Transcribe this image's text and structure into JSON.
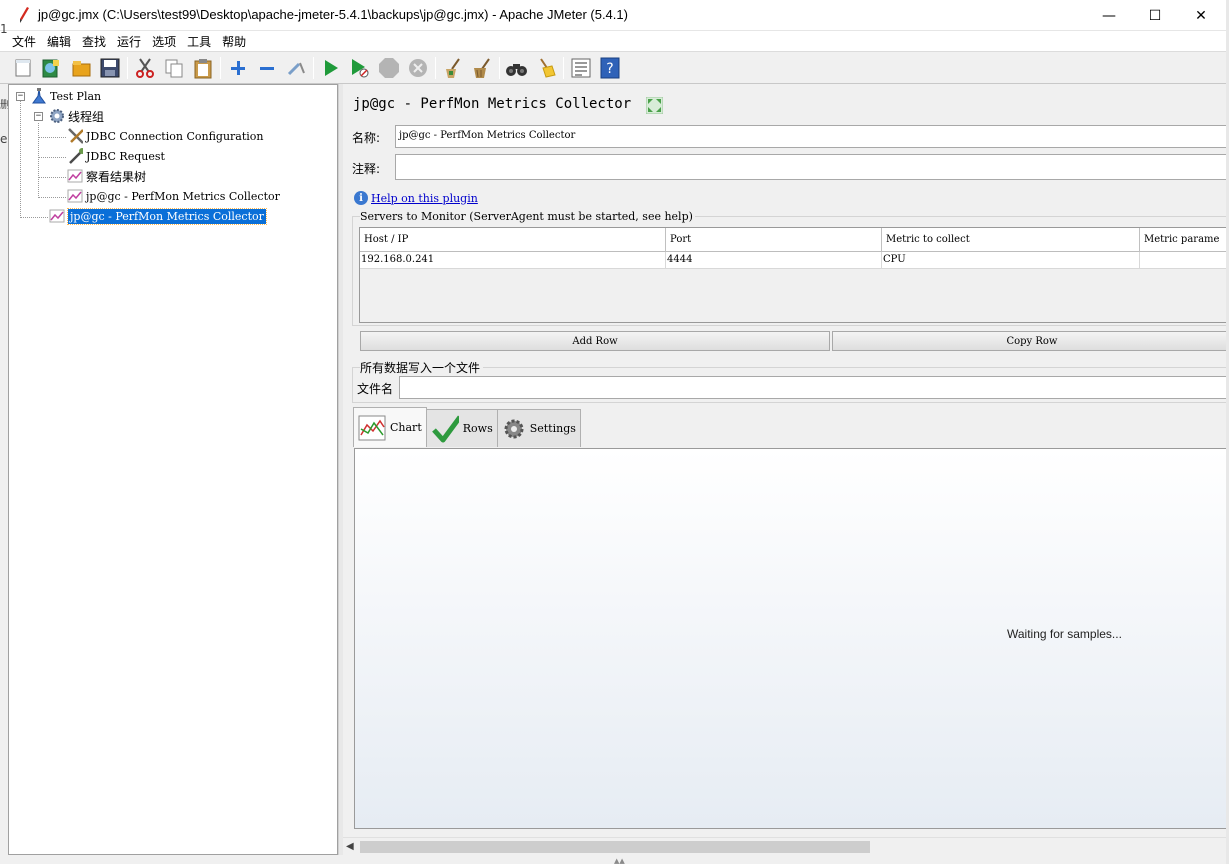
{
  "window": {
    "title": "jp@gc.jmx (C:\\Users\\test99\\Desktop\\apache-jmeter-5.4.1\\backups\\jp@gc.jmx) - Apache JMeter (5.4.1)",
    "minimize": "—",
    "maximize": "☐",
    "close": "✕"
  },
  "menu": [
    "文件",
    "编辑",
    "查找",
    "运行",
    "选项",
    "工具",
    "帮助"
  ],
  "background_fragments": [
    "1",
    "删",
    "e"
  ],
  "tree": {
    "items": [
      {
        "label": "Test Plan",
        "icon": "test-plan-icon"
      },
      {
        "label": "线程组",
        "icon": "gear-icon"
      },
      {
        "label": "JDBC Connection Configuration",
        "icon": "wrench-icon"
      },
      {
        "label": "JDBC Request",
        "icon": "pipette-icon"
      },
      {
        "label": "察看结果树",
        "icon": "chart-icon"
      },
      {
        "label": "jp@gc - PerfMon Metrics Collector",
        "icon": "chart-icon"
      },
      {
        "label": "jp@gc - PerfMon Metrics Collector",
        "icon": "chart-icon",
        "selected": true
      }
    ]
  },
  "panel": {
    "title": "jp@gc - PerfMon Metrics Collector",
    "name_label": "名称:",
    "name_value": "jp@gc - PerfMon Metrics Collector",
    "comment_label": "注释:",
    "comment_value": "",
    "help_link": "Help on this plugin",
    "servers_group": "Servers to Monitor (ServerAgent must be started, see help)",
    "table": {
      "columns": [
        "Host / IP",
        "Port",
        "Metric to collect",
        "Metric parame"
      ],
      "rows": [
        [
          "192.168.0.241",
          "4444",
          "CPU",
          ""
        ]
      ]
    },
    "add_row": "Add Row",
    "copy_row": "Copy Row",
    "file_group": "所有数据写入一个文件",
    "file_label": "文件名",
    "file_value": "",
    "tabs": [
      {
        "label": "Chart",
        "icon": "line-chart-icon",
        "active": true
      },
      {
        "label": "Rows",
        "icon": "checkmark-icon"
      },
      {
        "label": "Settings",
        "icon": "gear-icon"
      }
    ],
    "chart_message": "Waiting for samples..."
  }
}
